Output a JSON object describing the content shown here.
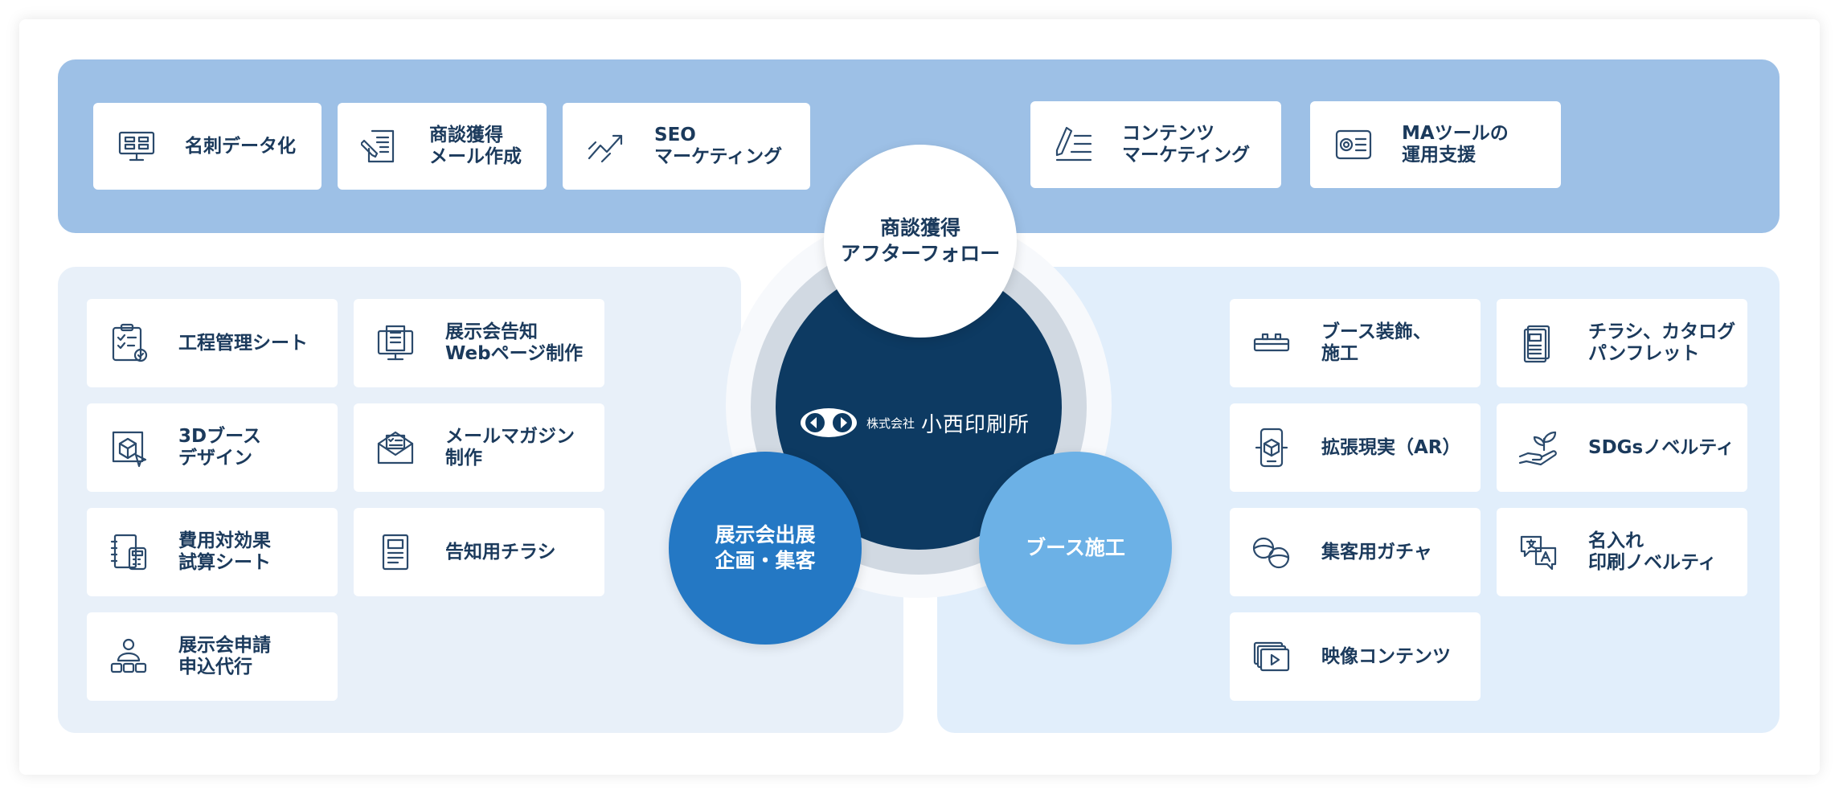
{
  "top_cards": [
    {
      "label": "名刺データ化",
      "icon": "business-card-scan-icon"
    },
    {
      "label": "商談獲得\nメール作成",
      "icon": "mail-writing-icon"
    },
    {
      "label": "SEO\nマーケティング",
      "icon": "trend-chart-icon"
    },
    {
      "label": "コンテンツ\nマーケティング",
      "icon": "pen-list-icon"
    },
    {
      "label": "MAツールの\n運用支援",
      "icon": "gear-list-icon"
    }
  ],
  "left_cards": [
    {
      "label": "工程管理シート",
      "icon": "clipboard-check-icon"
    },
    {
      "label": "展示会告知\nWebページ制作",
      "icon": "monitor-doc-icon"
    },
    {
      "label": "3Dブース\nデザイン",
      "icon": "cube-cursor-icon"
    },
    {
      "label": "メールマガジン\n制作",
      "icon": "envelope-list-icon"
    },
    {
      "label": "費用対効果\n試算シート",
      "icon": "calculator-notebook-icon"
    },
    {
      "label": "告知用チラシ",
      "icon": "flyer-icon"
    },
    {
      "label": "展示会申請\n申込代行",
      "icon": "person-boxes-icon"
    }
  ],
  "right_cards": [
    {
      "label": "ブース装飾、\n施工",
      "icon": "booth-counter-icon"
    },
    {
      "label": "チラシ、カタログ\nパンフレット",
      "icon": "catalog-icon"
    },
    {
      "label": "拡張現実（AR）",
      "icon": "phone-cube-icon"
    },
    {
      "label": "SDGsノベルティ",
      "icon": "hand-sprout-icon"
    },
    {
      "label": "集客用ガチャ",
      "icon": "capsule-toy-icon"
    },
    {
      "label": "名入れ\n印刷ノベルティ",
      "icon": "translate-bubble-icon"
    },
    {
      "label": "映像コンテンツ",
      "icon": "video-stack-icon"
    }
  ],
  "center": {
    "top_bubble": "商談獲得\nアフターフォロー",
    "left_bubble": "展示会出展\n企画・集客",
    "right_bubble": "ブース施工",
    "logo_small": "株式会社",
    "logo_big": "小西印刷所"
  },
  "colors": {
    "top_panel": "#9dc0e6",
    "left_panel": "#e8f0f9",
    "right_panel": "#e1eefb",
    "core": "#0d3a62",
    "left_bubble": "#2478c4",
    "right_bubble": "#6cb1e6",
    "text": "#1b3a5c"
  }
}
